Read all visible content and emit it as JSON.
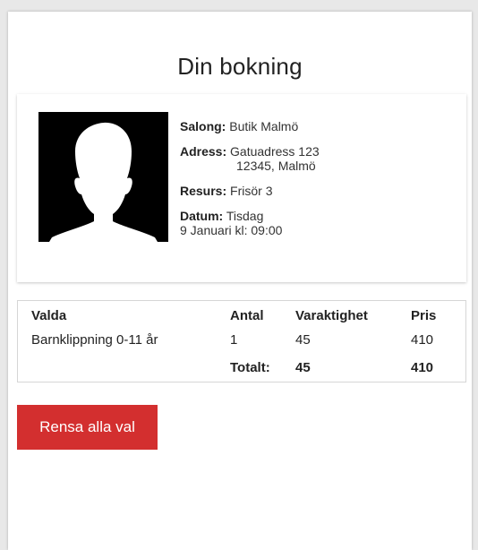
{
  "page": {
    "title": "Din bokning"
  },
  "booking": {
    "avatar_icon": "person-silhouette-icon",
    "salong_label": "Salong:",
    "salong_value": "Butik Malmö",
    "adress_label": "Adress:",
    "adress_line1": "Gatuadress 123",
    "adress_line2": "12345, Malmö",
    "resurs_label": "Resurs:",
    "resurs_value": "Frisör 3",
    "datum_label": "Datum:",
    "datum_day": "Tisdag",
    "datum_date_time": "9 Januari kl: 09:00"
  },
  "table": {
    "headers": {
      "valda": "Valda",
      "antal": "Antal",
      "varaktighet": "Varaktighet",
      "pris": "Pris"
    },
    "rows": [
      {
        "valda": "Barnklippning 0-11 år",
        "antal": "1",
        "varaktighet": "45",
        "pris": "410"
      }
    ],
    "total": {
      "label": "Totalt:",
      "varaktighet": "45",
      "pris": "410"
    }
  },
  "actions": {
    "clear_label": "Rensa alla val"
  },
  "colors": {
    "accent": "#d32f2f",
    "panel_background": "#ffffff",
    "page_background": "#e8e8e8"
  }
}
